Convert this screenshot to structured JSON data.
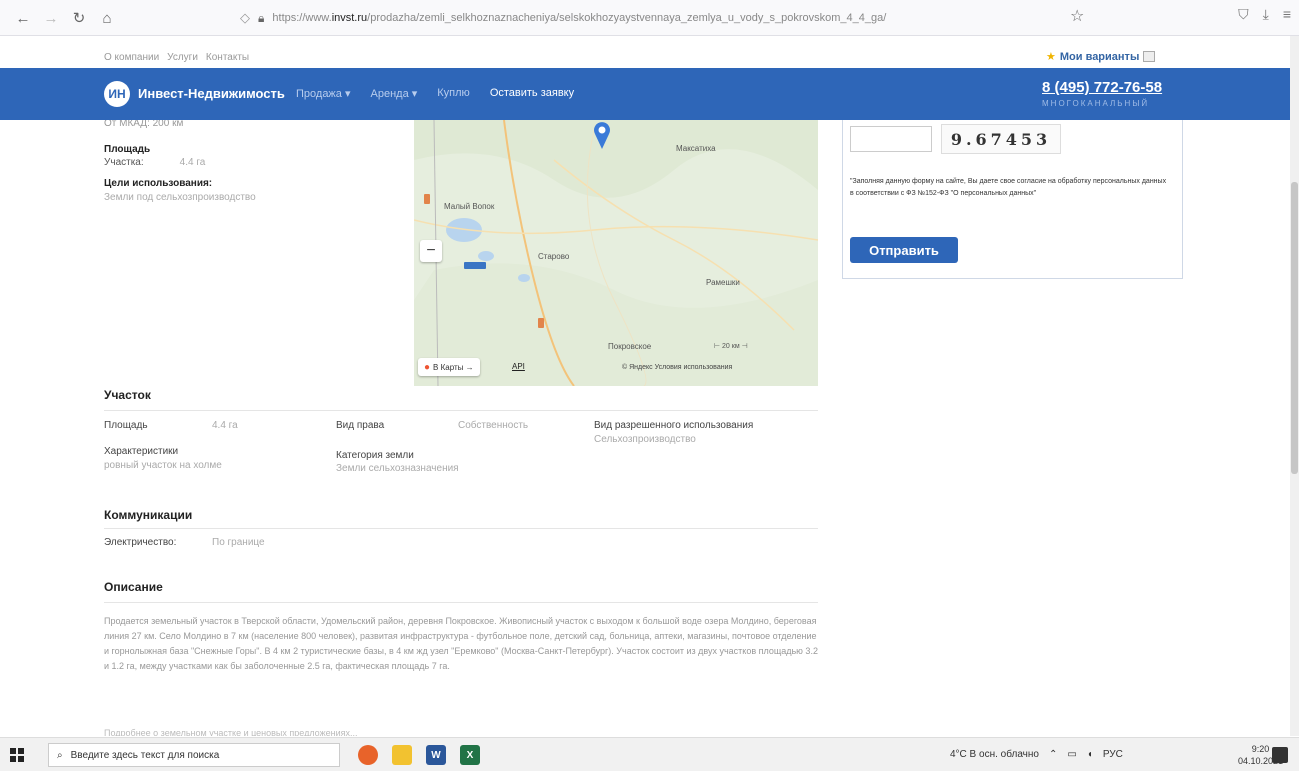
{
  "browser": {
    "url_prefix": "https://www.",
    "url_host": "invst.ru",
    "url_path": "/prodazha/zemli_selkhoznaznacheniya/selskokhozyaystvennaya_zemlya_u_vody_s_pokrovskom_4_4_ga/"
  },
  "site": {
    "top_links": [
      "О компании",
      "Услуги",
      "Контакты"
    ],
    "favorites": "Мои варианты",
    "logo_mark": "ИН",
    "logo_text": "Инвест-Недвижимость",
    "menu": [
      "Продажа ▾",
      "Аренда ▾",
      "Куплю",
      "Оставить заявку"
    ],
    "phone": "8 (495) 772-76-58",
    "phone_sub": "МНОГОКАНАЛЬНЫЙ"
  },
  "info": {
    "cut_text": "От МКАД:   200 км",
    "area_heading": "Площадь",
    "plot_label": "Участка:",
    "plot_value": "4.4 га",
    "purpose_heading": "Цели использования:",
    "purpose_value": "Земли под сельхозпроизводство"
  },
  "map": {
    "labels": [
      "Максатиха",
      "Малый Вопок",
      "Старово",
      "Рамешки",
      "Покровское"
    ],
    "to_maps": "В Карты →",
    "api": "API",
    "scale": "⊢ 20 км ⊣",
    "copyright": "© Яндекс Условия использования"
  },
  "form": {
    "captcha": "9.67453",
    "consent": "\"Заполняя данную форму на сайте, Вы даете свое согласие на обработку персональных данных в соответствии с ФЗ №152-ФЗ \"О персональных данных\"",
    "submit": "Отправить"
  },
  "plot": {
    "title": "Участок",
    "area_label": "Площадь",
    "area_value": "4.4 га",
    "right_label": "Вид права",
    "right_value": "Собственность",
    "usage_label": "Вид разрешенного использования",
    "usage_value": "Сельхозпроизводство",
    "char_label": "Характеристики",
    "char_value": "ровный участок на холме",
    "cat_label": "Категория земли",
    "cat_value": "Земли сельхозназначения"
  },
  "comm": {
    "title": "Коммуникации",
    "elec_label": "Электричество:",
    "elec_value": "По границе"
  },
  "desc": {
    "title": "Описание",
    "text": "Продается земельный участок в Тверской области, Удомельский район, деревня Покровское. Живописный участок с выходом к большой воде озера Молдино, береговая линия 27 км. Село Молдино в 7 км (население 800 человек), развитая инфраструктура - футбольное поле, детский сад, больница, аптеки, магазины, почтовое отделение и горнолыжная база \"Снежные Горы\". В 4 км 2 туристические базы, в 4 км жд узел \"Еремково\" (Москва-Санкт-Петербург). Участок состоит из двух участков площадью 3.2 и 1.2 га, между участками как бы заболоченные 2.5 га, фактическая площадь 7 га.",
    "cut": "Подробнее о земельном участке и ценовых предложениях..."
  },
  "taskbar": {
    "search_placeholder": "Введите здесь текст для поиска",
    "weather": "4°C  В осн. облачно",
    "lang": "РУС",
    "time": "9:20",
    "date": "04.10.2021"
  }
}
